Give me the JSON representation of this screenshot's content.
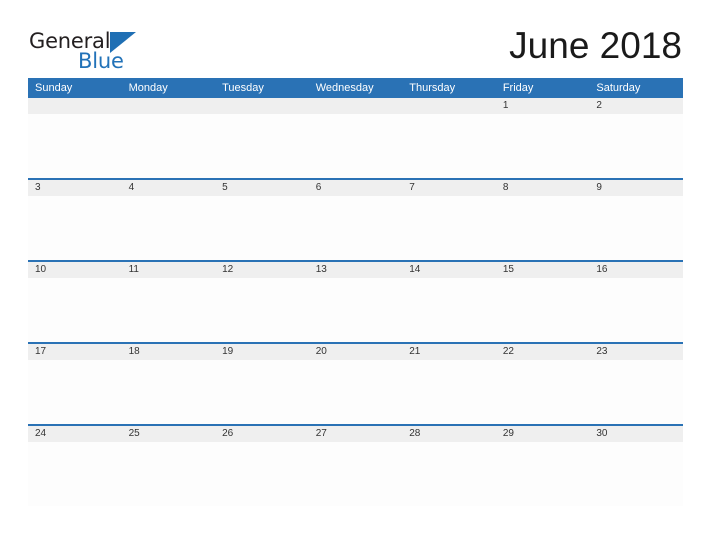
{
  "brand": {
    "name_part1": "General",
    "name_part2": "Blue",
    "flag_icon": "triangle-flag-icon",
    "accent_color": "#2272b8"
  },
  "header": {
    "title": "June 2018"
  },
  "calendar": {
    "month": "June",
    "year": "2018",
    "header_bg": "#2a72b5",
    "header_text_color": "#ffffff",
    "row_band_bg": "#efefef",
    "separator_color": "#2a72b5",
    "weekday_headers": [
      "Sunday",
      "Monday",
      "Tuesday",
      "Wednesday",
      "Thursday",
      "Friday",
      "Saturday"
    ],
    "weeks": [
      [
        "",
        "",
        "",
        "",
        "",
        "1",
        "2"
      ],
      [
        "3",
        "4",
        "5",
        "6",
        "7",
        "8",
        "9"
      ],
      [
        "10",
        "11",
        "12",
        "13",
        "14",
        "15",
        "16"
      ],
      [
        "17",
        "18",
        "19",
        "20",
        "21",
        "22",
        "23"
      ],
      [
        "24",
        "25",
        "26",
        "27",
        "28",
        "29",
        "30"
      ]
    ]
  }
}
